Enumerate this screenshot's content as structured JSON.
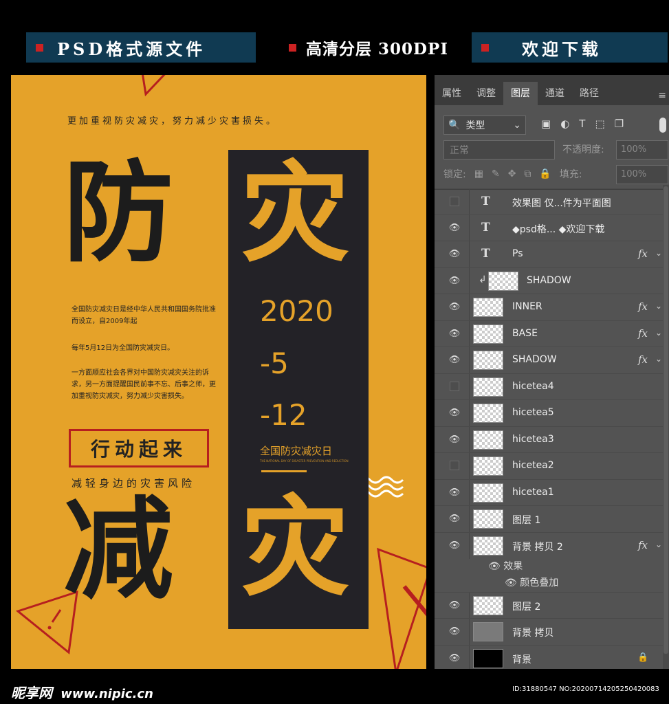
{
  "banner": {
    "items": [
      {
        "label": "PSD格式源文件"
      },
      {
        "label": "高清分层 300DPI"
      },
      {
        "label": "欢迎下载"
      }
    ],
    "accent": "#cc2222",
    "bg": "#103a52"
  },
  "poster": {
    "bg": "#e5a229",
    "tagline": "更加重视防灾减灾，努力减少灾害损失。",
    "big_chars": [
      "防",
      "灾",
      "减",
      "灾"
    ],
    "date_lines": [
      "2020",
      "-5",
      "-12"
    ],
    "day_name": "全国防灾减灾日",
    "tiny_text": "THE NATIONAL DAY OF DISASTER PREVENTION AND REDUCTION",
    "paragraphs": [
      "全国防灾减灾日是经中华人民共和国国务院批准而设立，自2009年起",
      "每年5月12日为全国防灾减灾日。",
      "一方面顺应社会各界对中国防灾减灾关注的诉求，另一方面提醒国民前事不忘、后事之师，更加重视防灾减灾，努力减少灾害损失。"
    ],
    "action_label": "行动起来",
    "action_sub": "减轻身边的灾害风险",
    "icons": [
      "warning-triangle-icon",
      "wave-lines-icon"
    ]
  },
  "panel": {
    "tabs": [
      "属性",
      "调整",
      "图层",
      "通道",
      "路径"
    ],
    "active_tab": "图层",
    "filter": {
      "label": "类型"
    },
    "blend_mode": "正常",
    "opacity_label": "不透明度:",
    "opacity_value": "100%",
    "lock_label": "锁定:",
    "fill_label": "填充:",
    "fill_value": "100%",
    "layers": [
      {
        "name": "效果图 仅...件为平面图",
        "type": "text",
        "visible": false
      },
      {
        "name": "◆psd格... ◆欢迎下载",
        "type": "text",
        "visible": true
      },
      {
        "name": "Ps",
        "type": "text",
        "visible": true,
        "fx": true
      },
      {
        "name": "SHADOW",
        "type": "clip",
        "visible": true
      },
      {
        "name": "INNER",
        "type": "image",
        "visible": true,
        "fx": true
      },
      {
        "name": "BASE",
        "type": "image",
        "visible": true,
        "fx": true
      },
      {
        "name": "SHADOW",
        "type": "image",
        "visible": true,
        "fx": true
      },
      {
        "name": "hicetea4",
        "type": "image",
        "visible": false
      },
      {
        "name": "hicetea5",
        "type": "image",
        "visible": true
      },
      {
        "name": "hicetea3",
        "type": "image",
        "visible": true
      },
      {
        "name": "hicetea2",
        "type": "image",
        "visible": false
      },
      {
        "name": "hicetea1",
        "type": "image",
        "visible": true
      },
      {
        "name": "图层 1",
        "type": "image",
        "visible": true
      },
      {
        "name": "背景 拷贝 2",
        "type": "image",
        "visible": true,
        "fx": true
      },
      {
        "name": "图层 2",
        "type": "image",
        "visible": true
      },
      {
        "name": "背景 拷贝",
        "type": "grey",
        "visible": true
      },
      {
        "name": "背景",
        "type": "black",
        "visible": true,
        "locked": true
      }
    ],
    "effects": {
      "label": "效果",
      "item": "颜色叠加"
    },
    "fx_label": "fx"
  },
  "footer": {
    "logo_cn": "昵享网",
    "logo_url": "www.nipic.cn",
    "watermark": "ID:31880547 NO:20200714205250420083"
  }
}
